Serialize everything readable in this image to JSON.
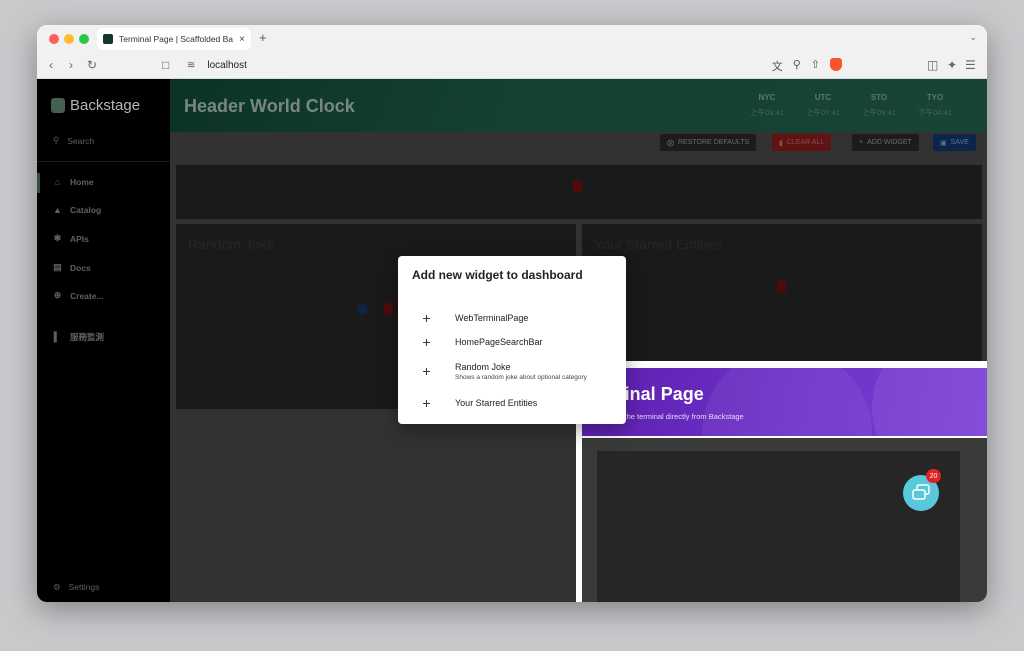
{
  "browser": {
    "tab_title": "Terminal Page | Scaffolded Ba",
    "tab_close": "×",
    "new_tab": "+",
    "url": "localhost"
  },
  "sidebar": {
    "logo_text": "Backstage",
    "search_label": "Search",
    "items": [
      {
        "label": "Home",
        "icon": "home-icon"
      },
      {
        "label": "Catalog",
        "icon": "catalog-icon"
      },
      {
        "label": "APIs",
        "icon": "extension-icon"
      },
      {
        "label": "Docs",
        "icon": "docs-icon"
      },
      {
        "label": "Create...",
        "icon": "create-icon"
      },
      {
        "label": "服務監測",
        "icon": "bar-chart-icon"
      }
    ],
    "settings_label": "Settings"
  },
  "header": {
    "title": "Header World Clock",
    "clocks": [
      {
        "label": "NYC",
        "time": "上午03:41"
      },
      {
        "label": "UTC",
        "time": "上午07:41"
      },
      {
        "label": "STO",
        "time": "上午09:41"
      },
      {
        "label": "TYO",
        "time": "下午04:41"
      }
    ]
  },
  "actions": {
    "restore": "RESTORE DEFAULTS",
    "clear": "CLEAR ALL",
    "add": "ADD WIDGET",
    "save": "SAVE"
  },
  "widgets": {
    "left_title": "Random Joke",
    "right_title": "Your Starred Entities"
  },
  "terminal": {
    "title": "Terminal Page",
    "subtitle": "Interact with the terminal directly from Backstage"
  },
  "dialog": {
    "title": "Add new widget to dashboard",
    "options": [
      {
        "label": "WebTerminalPage",
        "desc": ""
      },
      {
        "label": "HomePageSearchBar",
        "desc": ""
      },
      {
        "label": "Random Joke",
        "desc": "Shows a random joke about optional category"
      },
      {
        "label": "Your Starred Entities",
        "desc": ""
      }
    ]
  },
  "chat": {
    "badge": "20"
  },
  "colors": {
    "sidebar_bg": "#000000",
    "header_green": "#184b3a",
    "terminal_purple": "#6d32c8",
    "clear_red": "#6e1616",
    "save_blue": "#0d2c55",
    "chat_cyan": "#59c8dc"
  }
}
